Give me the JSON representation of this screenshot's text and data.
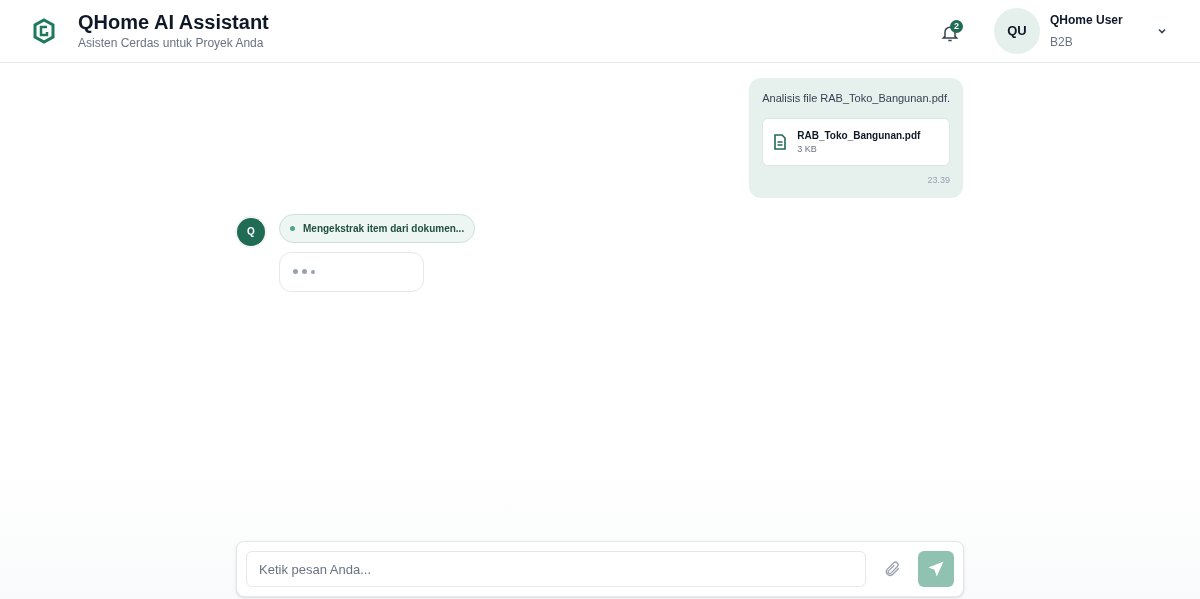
{
  "header": {
    "title": "QHome AI Assistant",
    "subtitle": "Asisten Cerdas untuk Proyek Anda",
    "notification_count": "2",
    "user": {
      "initials": "QU",
      "name": "QHome User",
      "role": "B2B"
    }
  },
  "messages": [
    {
      "kind": "user",
      "text": "Analisis file RAB_Toko_Bangunan.pdf.",
      "attachment": {
        "name": "RAB_Toko_Bangunan.pdf",
        "size": "3 KB"
      },
      "time": "23.39"
    },
    {
      "kind": "assistant",
      "avatar": "Q",
      "status": "Mengekstrak item dari dokumen...",
      "typing": true
    }
  ],
  "composer": {
    "placeholder": "Ketik pesan Anda...",
    "send_disabled": true
  }
}
